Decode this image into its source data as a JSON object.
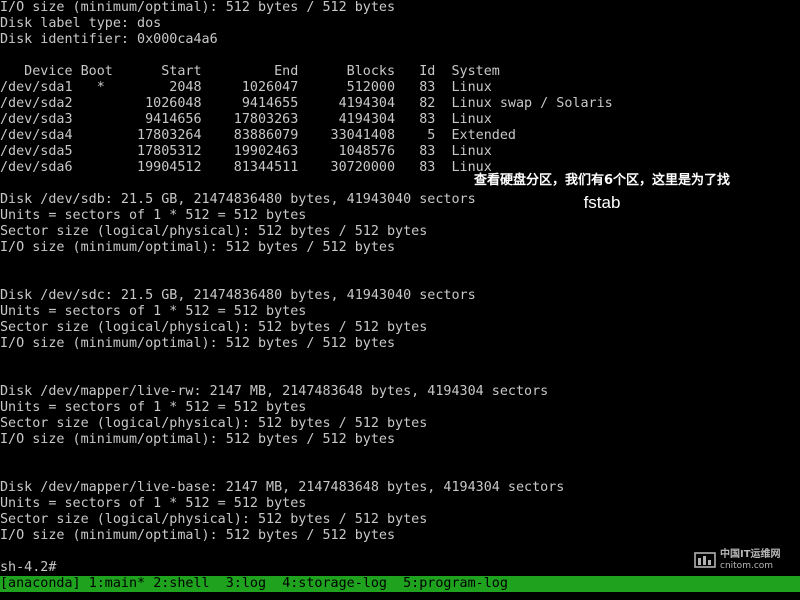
{
  "terminal": {
    "lines": [
      "I/O size (minimum/optimal): 512 bytes / 512 bytes",
      "Disk label type: dos",
      "Disk identifier: 0x000ca4a6",
      "",
      "   Device Boot      Start         End      Blocks   Id  System",
      "/dev/sda1   *        2048     1026047      512000   83  Linux",
      "/dev/sda2         1026048     9414655     4194304   82  Linux swap / Solaris",
      "/dev/sda3         9414656    17803263     4194304   83  Linux",
      "/dev/sda4        17803264    83886079    33041408    5  Extended",
      "/dev/sda5        17805312    19902463     1048576   83  Linux",
      "/dev/sda6        19904512    81344511    30720000   83  Linux",
      "",
      "Disk /dev/sdb: 21.5 GB, 21474836480 bytes, 41943040 sectors",
      "Units = sectors of 1 * 512 = 512 bytes",
      "Sector size (logical/physical): 512 bytes / 512 bytes",
      "I/O size (minimum/optimal): 512 bytes / 512 bytes",
      "",
      "",
      "Disk /dev/sdc: 21.5 GB, 21474836480 bytes, 41943040 sectors",
      "Units = sectors of 1 * 512 = 512 bytes",
      "Sector size (logical/physical): 512 bytes / 512 bytes",
      "I/O size (minimum/optimal): 512 bytes / 512 bytes",
      "",
      "",
      "Disk /dev/mapper/live-rw: 2147 MB, 2147483648 bytes, 4194304 sectors",
      "Units = sectors of 1 * 512 = 512 bytes",
      "Sector size (logical/physical): 512 bytes / 512 bytes",
      "I/O size (minimum/optimal): 512 bytes / 512 bytes",
      "",
      "",
      "Disk /dev/mapper/live-base: 2147 MB, 2147483648 bytes, 4194304 sectors",
      "Units = sectors of 1 * 512 = 512 bytes",
      "Sector size (logical/physical): 512 bytes / 512 bytes",
      "I/O size (minimum/optimal): 512 bytes / 512 bytes",
      "",
      "sh-4.2#"
    ]
  },
  "annotation": {
    "line1": "查看硬盘分区，我们有6个区，这里是为了找",
    "line2": "fstab"
  },
  "watermark": {
    "site_name": "中国IT运维网",
    "url": "cnitom.com"
  },
  "statusbar": {
    "tabs": [
      "[anaconda]",
      "1:main*",
      "2:shell",
      "3:log",
      "4:storage-log",
      "5:program-log"
    ]
  },
  "colors": {
    "background": "#000000",
    "text": "#c8c8c8",
    "statusbar": "#1fa31f"
  }
}
